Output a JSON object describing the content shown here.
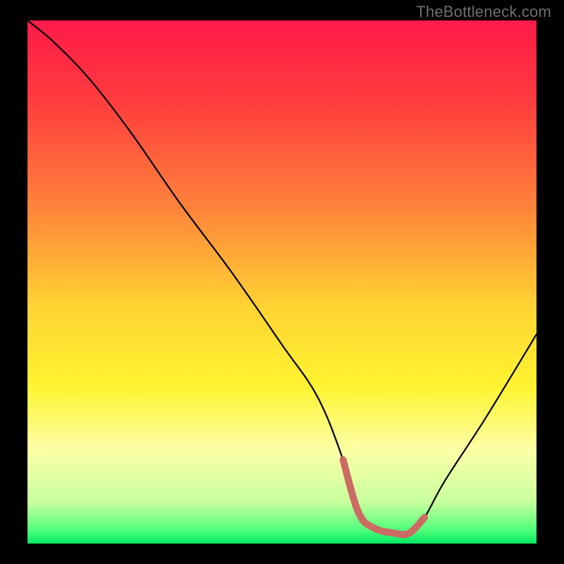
{
  "watermark": "TheBottleneck.com",
  "chart_data": {
    "type": "line",
    "title": "",
    "xlabel": "",
    "ylabel": "",
    "xlim": [
      0,
      100
    ],
    "ylim": [
      0,
      100
    ],
    "gradient_stops": [
      {
        "offset": 0.0,
        "color": "#ff1a49"
      },
      {
        "offset": 0.15,
        "color": "#ff3b3f"
      },
      {
        "offset": 0.35,
        "color": "#ff803a"
      },
      {
        "offset": 0.55,
        "color": "#ffd433"
      },
      {
        "offset": 0.7,
        "color": "#fff430"
      },
      {
        "offset": 0.82,
        "color": "#fdffa6"
      },
      {
        "offset": 0.92,
        "color": "#c8ff9e"
      },
      {
        "offset": 0.975,
        "color": "#4eff7a"
      },
      {
        "offset": 1.0,
        "color": "#00e865"
      }
    ],
    "series": [
      {
        "name": "bottleneck-curve",
        "x": [
          0,
          5,
          12,
          20,
          30,
          40,
          50,
          57,
          62,
          65,
          70,
          75,
          78,
          82,
          90,
          100
        ],
        "y": [
          100,
          96,
          89,
          79,
          65,
          52,
          38,
          28,
          16,
          6,
          2,
          2,
          5,
          12,
          24,
          40
        ]
      }
    ],
    "highlight_segment": {
      "name": "flat-minimum",
      "color": "#cb6b63",
      "x": [
        62,
        65,
        68,
        72,
        75,
        78
      ],
      "y": [
        16,
        6,
        3,
        2,
        2,
        5
      ]
    }
  }
}
